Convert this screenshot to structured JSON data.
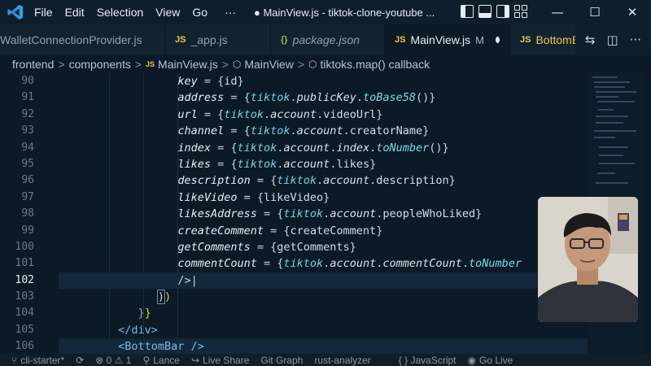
{
  "menu": [
    "File",
    "Edit",
    "Selection",
    "View",
    "Go"
  ],
  "menu_more": "···",
  "window_title": "● MainView.js - tiktok-clone-youtube ...",
  "window_controls": {
    "minimize": "—",
    "maximize": "☐",
    "close": "✕"
  },
  "tabs": [
    {
      "label": "WalletConnectionProvider.js",
      "icon": "js-file-icon",
      "active": false
    },
    {
      "label": "_app.js",
      "icon": "JS",
      "active": false
    },
    {
      "label": "package.json",
      "icon": "{}",
      "active": false
    },
    {
      "label": "MainView.js",
      "icon": "JS",
      "active": true,
      "modified": "M"
    },
    {
      "label": "BottomB",
      "icon": "JS",
      "active": false
    }
  ],
  "breadcrumb": {
    "parts": [
      "frontend",
      "components",
      "MainView.js",
      "MainView",
      "tiktoks.map() callback"
    ],
    "separator": ">"
  },
  "editor": {
    "line_numbers": [
      "90",
      "91",
      "92",
      "93",
      "94",
      "95",
      "96",
      "97",
      "98",
      "99",
      "100",
      "101",
      "102",
      "103",
      "104",
      "105",
      "106"
    ],
    "current_line": "102"
  },
  "status": {
    "branch": "cli-starter*",
    "problems": "⊗ 0 ⚠ 1",
    "lance": "Lance",
    "live_share": "Live Share",
    "git_graph": "Git Graph",
    "rust": "rust-analyzer",
    "language": "{ } JavaScript",
    "go_live": "Go Live"
  },
  "colors": {
    "editor_bg": "#0b1a26",
    "chrome_bg": "#0f1e2b",
    "accent_cyan": "#6fd3e8",
    "js_yellow": "#e8c84a"
  }
}
